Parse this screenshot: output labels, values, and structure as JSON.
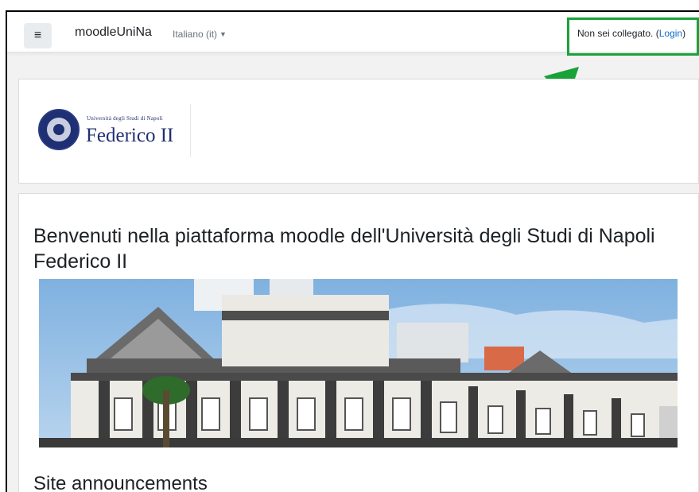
{
  "navbar": {
    "menu_icon": "hamburger-menu-icon",
    "brand": "moodleUniNa",
    "language": "Italiano (it)",
    "login_status": "Non sei collegato. (",
    "login_link": "Login",
    "login_suffix": ")"
  },
  "header": {
    "logo_line1": "Università degli Studi di Napoli",
    "logo_line2": "Federico II"
  },
  "main": {
    "welcome_title": "Benvenuti nella piattaforma moodle dell'Università degli Studi di Napoli Federico II",
    "section_title": "Site announcements"
  },
  "colors": {
    "highlight": "#1aa23a",
    "link": "#0f6cbf",
    "brand_blue": "#1f2f73"
  }
}
